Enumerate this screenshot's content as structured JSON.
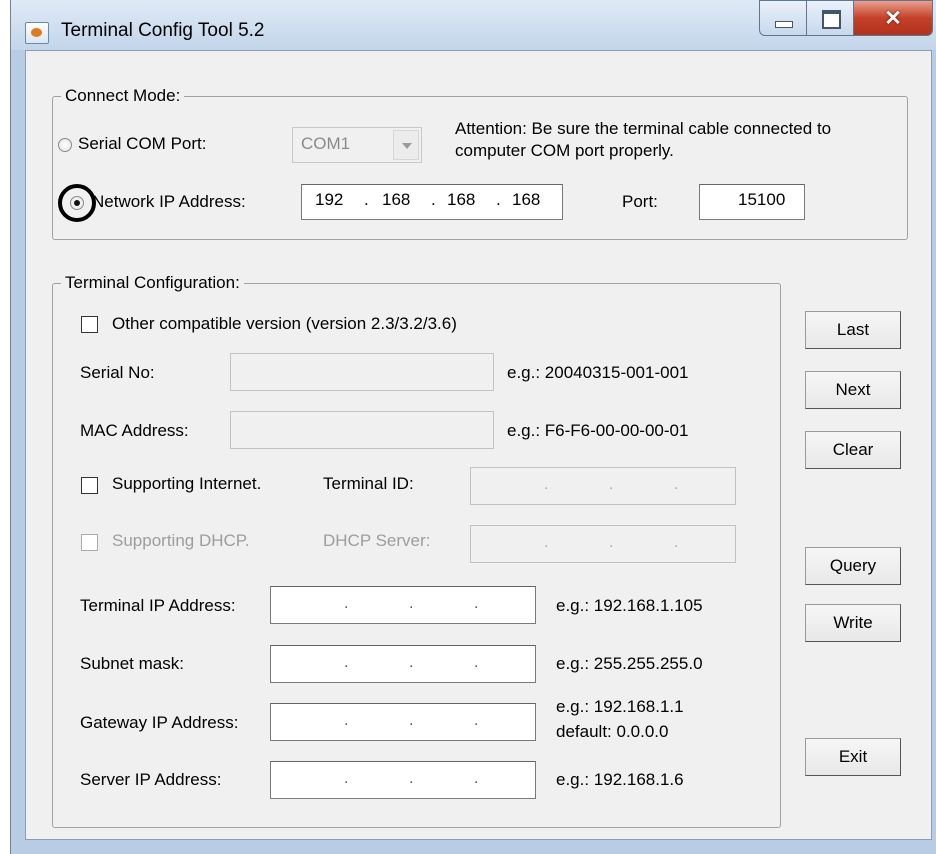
{
  "window": {
    "title": "Terminal Config Tool 5.2"
  },
  "connect_mode": {
    "label": "Connect Mode:",
    "serial_label": "Serial COM Port:",
    "com_port_value": "COM1",
    "attention": "Attention: Be sure the terminal cable connected to",
    "attention_line2": "computer COM port properly.",
    "network_label": "Network IP Address:",
    "ip": [
      "192",
      "168",
      "168",
      "168"
    ],
    "port_label": "Port:",
    "port_value": "15100",
    "selected": "network"
  },
  "terminal_config": {
    "label": "Terminal Configuration:",
    "other_version_label": "Other compatible version (version 2.3/3.2/3.6)",
    "serial_no_label": "Serial No:",
    "serial_no_example": "e.g.: 20040315-001-001",
    "mac_label": "MAC Address:",
    "mac_example": "e.g.: F6-F6-00-00-00-01",
    "supporting_internet_label": "Supporting Internet.",
    "terminal_id_label": "Terminal ID:",
    "supporting_dhcp_label": "Supporting DHCP.",
    "dhcp_server_label": "DHCP Server:",
    "terminal_ip_label": "Terminal IP Address:",
    "terminal_ip_example": "e.g.: 192.168.1.105",
    "subnet_label": "Subnet mask:",
    "subnet_example": "e.g.: 255.255.255.0",
    "gateway_label": "Gateway IP Address:",
    "gateway_example": "e.g.: 192.168.1.1",
    "gateway_default": "default: 0.0.0.0",
    "server_ip_label": "Server IP Address:",
    "server_ip_example": "e.g.: 192.168.1.6"
  },
  "buttons": {
    "last": "Last",
    "next": "Next",
    "clear": "Clear",
    "query": "Query",
    "write": "Write",
    "exit": "Exit"
  }
}
